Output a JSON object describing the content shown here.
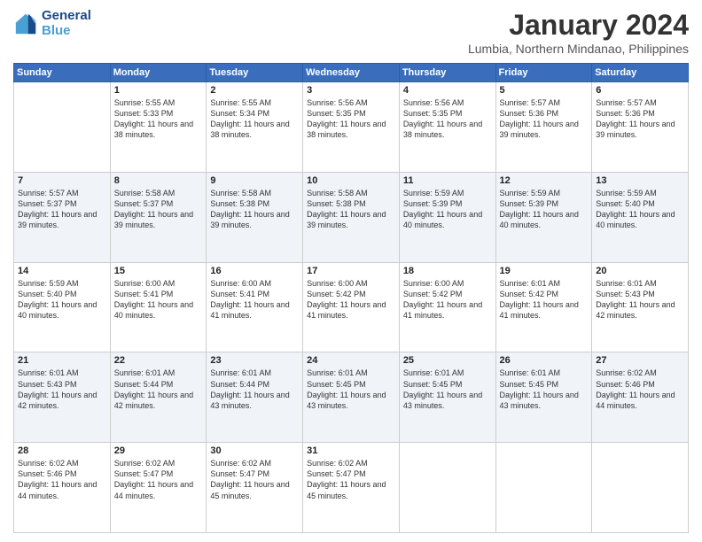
{
  "logo": {
    "line1": "General",
    "line2": "Blue"
  },
  "title": "January 2024",
  "location": "Lumbia, Northern Mindanao, Philippines",
  "days_header": [
    "Sunday",
    "Monday",
    "Tuesday",
    "Wednesday",
    "Thursday",
    "Friday",
    "Saturday"
  ],
  "weeks": [
    [
      {
        "day": "",
        "sunrise": "",
        "sunset": "",
        "daylight": ""
      },
      {
        "day": "1",
        "sunrise": "Sunrise: 5:55 AM",
        "sunset": "Sunset: 5:33 PM",
        "daylight": "Daylight: 11 hours and 38 minutes."
      },
      {
        "day": "2",
        "sunrise": "Sunrise: 5:55 AM",
        "sunset": "Sunset: 5:34 PM",
        "daylight": "Daylight: 11 hours and 38 minutes."
      },
      {
        "day": "3",
        "sunrise": "Sunrise: 5:56 AM",
        "sunset": "Sunset: 5:35 PM",
        "daylight": "Daylight: 11 hours and 38 minutes."
      },
      {
        "day": "4",
        "sunrise": "Sunrise: 5:56 AM",
        "sunset": "Sunset: 5:35 PM",
        "daylight": "Daylight: 11 hours and 38 minutes."
      },
      {
        "day": "5",
        "sunrise": "Sunrise: 5:57 AM",
        "sunset": "Sunset: 5:36 PM",
        "daylight": "Daylight: 11 hours and 39 minutes."
      },
      {
        "day": "6",
        "sunrise": "Sunrise: 5:57 AM",
        "sunset": "Sunset: 5:36 PM",
        "daylight": "Daylight: 11 hours and 39 minutes."
      }
    ],
    [
      {
        "day": "7",
        "sunrise": "Sunrise: 5:57 AM",
        "sunset": "Sunset: 5:37 PM",
        "daylight": "Daylight: 11 hours and 39 minutes."
      },
      {
        "day": "8",
        "sunrise": "Sunrise: 5:58 AM",
        "sunset": "Sunset: 5:37 PM",
        "daylight": "Daylight: 11 hours and 39 minutes."
      },
      {
        "day": "9",
        "sunrise": "Sunrise: 5:58 AM",
        "sunset": "Sunset: 5:38 PM",
        "daylight": "Daylight: 11 hours and 39 minutes."
      },
      {
        "day": "10",
        "sunrise": "Sunrise: 5:58 AM",
        "sunset": "Sunset: 5:38 PM",
        "daylight": "Daylight: 11 hours and 39 minutes."
      },
      {
        "day": "11",
        "sunrise": "Sunrise: 5:59 AM",
        "sunset": "Sunset: 5:39 PM",
        "daylight": "Daylight: 11 hours and 40 minutes."
      },
      {
        "day": "12",
        "sunrise": "Sunrise: 5:59 AM",
        "sunset": "Sunset: 5:39 PM",
        "daylight": "Daylight: 11 hours and 40 minutes."
      },
      {
        "day": "13",
        "sunrise": "Sunrise: 5:59 AM",
        "sunset": "Sunset: 5:40 PM",
        "daylight": "Daylight: 11 hours and 40 minutes."
      }
    ],
    [
      {
        "day": "14",
        "sunrise": "Sunrise: 5:59 AM",
        "sunset": "Sunset: 5:40 PM",
        "daylight": "Daylight: 11 hours and 40 minutes."
      },
      {
        "day": "15",
        "sunrise": "Sunrise: 6:00 AM",
        "sunset": "Sunset: 5:41 PM",
        "daylight": "Daylight: 11 hours and 40 minutes."
      },
      {
        "day": "16",
        "sunrise": "Sunrise: 6:00 AM",
        "sunset": "Sunset: 5:41 PM",
        "daylight": "Daylight: 11 hours and 41 minutes."
      },
      {
        "day": "17",
        "sunrise": "Sunrise: 6:00 AM",
        "sunset": "Sunset: 5:42 PM",
        "daylight": "Daylight: 11 hours and 41 minutes."
      },
      {
        "day": "18",
        "sunrise": "Sunrise: 6:00 AM",
        "sunset": "Sunset: 5:42 PM",
        "daylight": "Daylight: 11 hours and 41 minutes."
      },
      {
        "day": "19",
        "sunrise": "Sunrise: 6:01 AM",
        "sunset": "Sunset: 5:42 PM",
        "daylight": "Daylight: 11 hours and 41 minutes."
      },
      {
        "day": "20",
        "sunrise": "Sunrise: 6:01 AM",
        "sunset": "Sunset: 5:43 PM",
        "daylight": "Daylight: 11 hours and 42 minutes."
      }
    ],
    [
      {
        "day": "21",
        "sunrise": "Sunrise: 6:01 AM",
        "sunset": "Sunset: 5:43 PM",
        "daylight": "Daylight: 11 hours and 42 minutes."
      },
      {
        "day": "22",
        "sunrise": "Sunrise: 6:01 AM",
        "sunset": "Sunset: 5:44 PM",
        "daylight": "Daylight: 11 hours and 42 minutes."
      },
      {
        "day": "23",
        "sunrise": "Sunrise: 6:01 AM",
        "sunset": "Sunset: 5:44 PM",
        "daylight": "Daylight: 11 hours and 43 minutes."
      },
      {
        "day": "24",
        "sunrise": "Sunrise: 6:01 AM",
        "sunset": "Sunset: 5:45 PM",
        "daylight": "Daylight: 11 hours and 43 minutes."
      },
      {
        "day": "25",
        "sunrise": "Sunrise: 6:01 AM",
        "sunset": "Sunset: 5:45 PM",
        "daylight": "Daylight: 11 hours and 43 minutes."
      },
      {
        "day": "26",
        "sunrise": "Sunrise: 6:01 AM",
        "sunset": "Sunset: 5:45 PM",
        "daylight": "Daylight: 11 hours and 43 minutes."
      },
      {
        "day": "27",
        "sunrise": "Sunrise: 6:02 AM",
        "sunset": "Sunset: 5:46 PM",
        "daylight": "Daylight: 11 hours and 44 minutes."
      }
    ],
    [
      {
        "day": "28",
        "sunrise": "Sunrise: 6:02 AM",
        "sunset": "Sunset: 5:46 PM",
        "daylight": "Daylight: 11 hours and 44 minutes."
      },
      {
        "day": "29",
        "sunrise": "Sunrise: 6:02 AM",
        "sunset": "Sunset: 5:47 PM",
        "daylight": "Daylight: 11 hours and 44 minutes."
      },
      {
        "day": "30",
        "sunrise": "Sunrise: 6:02 AM",
        "sunset": "Sunset: 5:47 PM",
        "daylight": "Daylight: 11 hours and 45 minutes."
      },
      {
        "day": "31",
        "sunrise": "Sunrise: 6:02 AM",
        "sunset": "Sunset: 5:47 PM",
        "daylight": "Daylight: 11 hours and 45 minutes."
      },
      {
        "day": "",
        "sunrise": "",
        "sunset": "",
        "daylight": ""
      },
      {
        "day": "",
        "sunrise": "",
        "sunset": "",
        "daylight": ""
      },
      {
        "day": "",
        "sunrise": "",
        "sunset": "",
        "daylight": ""
      }
    ]
  ]
}
